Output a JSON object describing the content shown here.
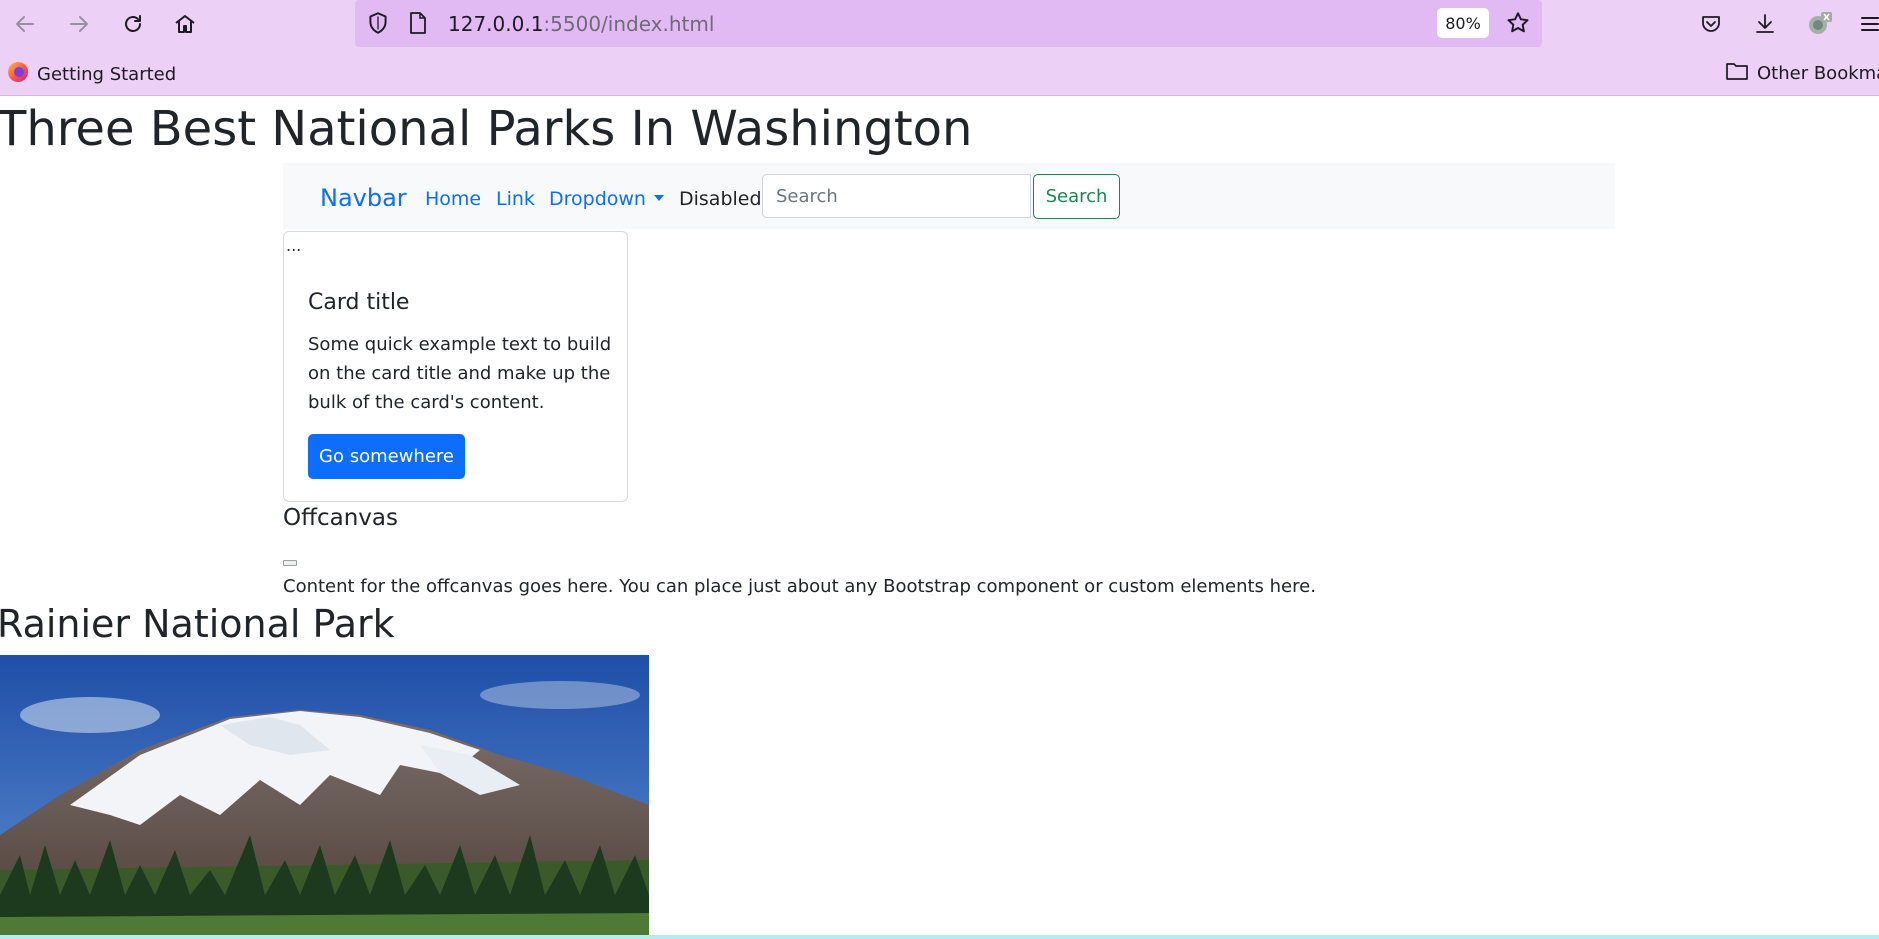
{
  "browser": {
    "url_host": "127.0.0.1",
    "url_path": ":5500/index.html",
    "zoom": "80%",
    "bookmarks": {
      "getting_started": "Getting Started",
      "other_bookmarks": "Other Bookmarks"
    },
    "icons": [
      "back-arrow-icon",
      "forward-arrow-icon",
      "reload-icon",
      "home-icon",
      "shield-icon",
      "page-icon",
      "star-icon",
      "pocket-icon",
      "download-icon",
      "extension-icon",
      "menu-icon",
      "firefox-icon",
      "folder-icon"
    ]
  },
  "page": {
    "title": "Three Best National Parks In Washington",
    "navbar": {
      "brand": "Navbar",
      "home": "Home",
      "link": "Link",
      "dropdown": "Dropdown",
      "disabled": "Disabled",
      "search_placeholder": "Search",
      "search_button": "Search"
    },
    "card": {
      "image_alt": "...",
      "title": "Card title",
      "text": "Some quick example text to build on the card title and make up the bulk of the card's content.",
      "button": "Go somewhere"
    },
    "offcanvas": {
      "title": "Offcanvas",
      "body": "Content for the offcanvas goes here. You can place just about any Bootstrap component or custom elements here."
    },
    "park_heading": "Rainier National Park"
  },
  "colors": {
    "chrome_bg": "#ecd0f5",
    "urlbar_bg": "#e2baf3",
    "link_blue": "#0d6efd",
    "success_green": "#198754",
    "navbar_bg": "#f8f9fa"
  }
}
